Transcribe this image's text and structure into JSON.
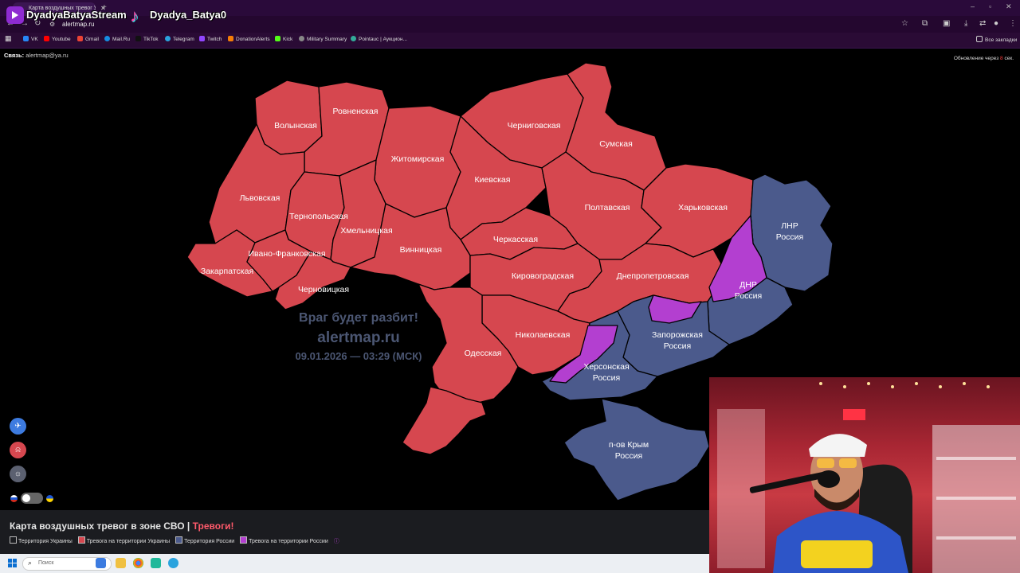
{
  "browser": {
    "tab_title": "Карта воздушных тревог Укр",
    "url": "alertmap.ru",
    "bookmarks": [
      "VK",
      "Youtube",
      "Gmail",
      "Mail.Ru",
      "TikTok",
      "Telegram",
      "Twitch",
      "DonationAlerts",
      "Kick",
      "Military Summary",
      "Pointauc | Аукцион..."
    ],
    "all_bookmarks": "Все закладки"
  },
  "overlay": {
    "stream_name": "DyadyaBatyaStream",
    "tiktok_name": "Dyadya_Batya0"
  },
  "page": {
    "contact_label": "Связь:",
    "contact_email": "alertmap@ya.ru",
    "update_prefix": "Обновление через",
    "update_seconds": "8",
    "update_suffix": "сек.",
    "slogan": "Враг будет разбит!",
    "site": "alertmap.ru",
    "datetime": "09.01.2026 — 03:29 (МСК)"
  },
  "colors": {
    "ukraine_alert": "#d6474f",
    "russia": "#4b5a8c",
    "russia_alert": "#b33fd0",
    "border": "#000000"
  },
  "regions": {
    "volyn": "Волынская",
    "rivne": "Ровненская",
    "zhytomyr": "Житомирская",
    "chernihiv": "Черниговская",
    "sumy": "Сумская",
    "kyiv": "Киевская",
    "lviv": "Львовская",
    "ternopil": "Тернопольская",
    "khmelnytskyi": "Хмельницкая",
    "poltava": "Полтавская",
    "kharkiv": "Харьковская",
    "lnr1": "ЛНР",
    "lnr2": "Россия",
    "cherkasy": "Черкасская",
    "zakarpattia": "Закарпатская",
    "ivano": "Ивано-Франковская",
    "vinnytsia": "Винницкая",
    "kirovohrad": "Кировоградская",
    "dnipro": "Днепропетровская",
    "dnr1": "ДНР",
    "dnr2": "Россия",
    "chernivtsi": "Черновицкая",
    "zaporizhzhia1": "Запорожская",
    "zaporizhzhia2": "Россия",
    "mykolaiv": "Николаевская",
    "odesa": "Одесская",
    "kherson1": "Херсонская",
    "kherson2": "Россия",
    "crimea1": "п-ов Крым",
    "crimea2": "Россия"
  },
  "footer": {
    "title": "Карта воздушных тревог в зоне СВО |",
    "alert": "Тревоги!",
    "legend": [
      "Территория Украины",
      "Тревога на территории Украины",
      "Территория России",
      "Тревога на территории России"
    ],
    "legend_colors": [
      "#1b1c20",
      "#d6474f",
      "#4b5a8c",
      "#b33fd0"
    ]
  },
  "taskbar": {
    "search_placeholder": "Поиск"
  }
}
